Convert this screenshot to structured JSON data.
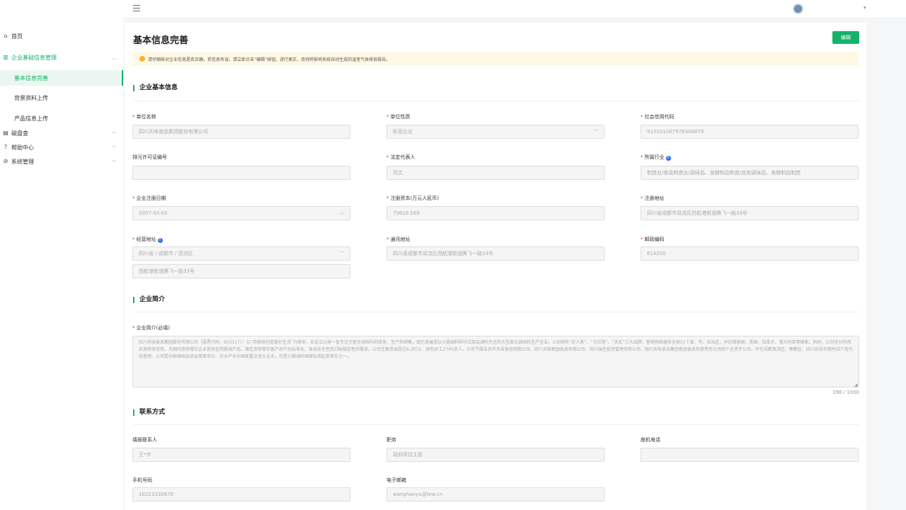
{
  "nav": {
    "home": "首页",
    "group_enterprise": "企业基础信息管理",
    "sub_basic": "基本信息完善",
    "sub_background": "背景资料上传",
    "sub_product": "产品信息上传",
    "carbon": "碳盘查",
    "help": "帮助中心",
    "system": "系统管理"
  },
  "page": {
    "title": "基本信息完善",
    "edit_button": "编辑",
    "notice": "请仔细核对企业信息是否正确，若信息有误，请立即点击“编辑”按钮，进行更正，否则将影响系统自动生成的温室气体排放报告。"
  },
  "sections": {
    "basic": "企业基本信息",
    "intro": "企业简介",
    "contact": "联系方式"
  },
  "basic_fields": {
    "unit_name_label": "单位名称",
    "unit_name": "四川天味食品集团股份有限公司",
    "unit_type_label": "单位性质",
    "unit_type": "私营企业",
    "credit_code_label": "社会信用代码",
    "credit_code": "915101007978308879",
    "permit_label": "排污许可证编号",
    "permit": "",
    "legal_rep_label": "法定代表人",
    "legal_rep": "邓文",
    "industry_label": "所属行业",
    "industry": "制造业/食品制造业/调味品、发酵制品制造/其他调味品、发酵制品制造",
    "reg_date_label": "企业注册日期",
    "reg_date": "2007-03-02",
    "capital_label": "注册资本(万元人民币)",
    "capital": "75618.569",
    "reg_address_label": "注册地址",
    "reg_address": "四川省成都市双流区西航港街道腾飞一路33号",
    "biz_address_label": "经营地址",
    "biz_region": "四川省 / 成都市 / 双流区",
    "biz_street": "西航港街道腾飞一路33号",
    "mail_address_label": "通讯地址",
    "mail_address": "四川省成都市双流区西航港街道腾飞一路33号",
    "postcode_label": "邮政编码",
    "postcode": "614200"
  },
  "intro": {
    "label": "企业简介(必填)",
    "text": "四川天味食品集团股份有限公司（股票代码：603317））以“用美味创造美好生活”为使命，自设立以来一直专注于复合调味料的研发、生产和销售，现已发展成以火锅调料和中式菜品调料为主的大型复合调味料生产企业。公司拥有“好人家”、“大红袍”、“天车”三大品牌，营销网络遍布全国31个省、市、自治区，并远销美国、英国、加拿大、澳大利亚等国家。同时，公司充分利用自身研发优势，为国内连锁餐饮企业提供定制餐调产品，满足连锁餐饮客户对产品标准化、食品安全性及口味稳定性的需求。公司注册资本超过6.3亿元，现有员工2740余人。公司下属自贡市天味食品有限公司、四川天味家园食品有限公司、四川瑞生投资管理有限公司、四川天味食品集团家园食品有限责任公司四个全资子公司，并在成都双流区、郫都区、四川自贡市拥有四个现代化基地。公司是中国调味品协会理事单位、农业产业化国家重点龙头企业，也是火锅调料国家标准起草单位之一。",
    "counter": "398 / 1000"
  },
  "contact": {
    "contact_person_label": "填报联系人",
    "contact_person": "王*宇",
    "position_label": "职务",
    "position": "政府项目主管",
    "landline_label": "座机电话",
    "landline": "",
    "mobile_label": "手机号码",
    "mobile": "18223330676",
    "email_label": "电子邮箱",
    "email": "wanghanyu@tew.cn"
  },
  "colors": {
    "accent": "#17b26a",
    "required": "#f5222d",
    "notice_bg": "#fff8e5",
    "info": "#2f6fe8"
  }
}
